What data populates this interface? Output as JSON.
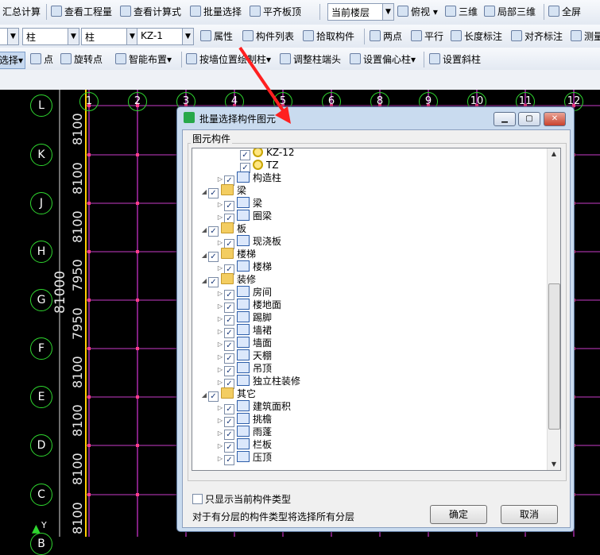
{
  "toolbar1": {
    "items": [
      "汇总计算",
      "查看工程量",
      "查看计算式",
      "批量选择",
      "平齐板顶"
    ],
    "floor_combo": "当前楼层",
    "view_items": [
      "俯视",
      "三维",
      "局部三维",
      "全屏"
    ]
  },
  "toolbar2": {
    "combo1": "柱",
    "combo2": "柱",
    "combo3": "KZ-1",
    "items": [
      "属性",
      "构件列表",
      "拾取构件",
      "两点",
      "平行",
      "长度标注",
      "对齐标注",
      "测量"
    ]
  },
  "toolbar3": {
    "items": [
      "选择",
      "点",
      "旋转点",
      "智能布置",
      "按墙位置绘制柱",
      "调整柱端头",
      "设置偏心柱",
      "设置斜柱"
    ]
  },
  "canvas": {
    "axis_rows": [
      "L",
      "K",
      "J",
      "H",
      "G",
      "F",
      "E",
      "D",
      "C",
      "B"
    ],
    "col_numbers": [
      "1",
      "2",
      "3",
      "4",
      "5",
      "6",
      "8",
      "9",
      "10",
      "11",
      "12"
    ],
    "dims": [
      "8100",
      "8100",
      "8100",
      "7950",
      "7950",
      "8100",
      "8100",
      "8100",
      "8100"
    ],
    "total_dim": "81000",
    "y_axis_label": "Y"
  },
  "dialog": {
    "title": "批量选择构件图元",
    "group_label": "图元构件",
    "tree": [
      {
        "label": "KZ-12",
        "level": 3,
        "icon": "gear-icon"
      },
      {
        "label": "TZ",
        "level": 3,
        "icon": "gear-icon"
      },
      {
        "label": "构造柱",
        "level": 2,
        "icon": "component-icon"
      },
      {
        "label": "梁",
        "level": 1,
        "icon": "folder-icon"
      },
      {
        "label": "梁",
        "level": 2,
        "icon": "component-icon"
      },
      {
        "label": "圈梁",
        "level": 2,
        "icon": "component-icon"
      },
      {
        "label": "板",
        "level": 1,
        "icon": "folder-icon"
      },
      {
        "label": "现浇板",
        "level": 2,
        "icon": "component-icon"
      },
      {
        "label": "楼梯",
        "level": 1,
        "icon": "folder-icon"
      },
      {
        "label": "楼梯",
        "level": 2,
        "icon": "component-icon"
      },
      {
        "label": "装修",
        "level": 1,
        "icon": "folder-icon"
      },
      {
        "label": "房间",
        "level": 2,
        "icon": "component-icon"
      },
      {
        "label": "楼地面",
        "level": 2,
        "icon": "component-icon"
      },
      {
        "label": "踢脚",
        "level": 2,
        "icon": "component-icon"
      },
      {
        "label": "墙裙",
        "level": 2,
        "icon": "component-icon"
      },
      {
        "label": "墙面",
        "level": 2,
        "icon": "component-icon"
      },
      {
        "label": "天棚",
        "level": 2,
        "icon": "component-icon"
      },
      {
        "label": "吊顶",
        "level": 2,
        "icon": "component-icon"
      },
      {
        "label": "独立柱装修",
        "level": 2,
        "icon": "component-icon"
      },
      {
        "label": "其它",
        "level": 1,
        "icon": "folder-icon"
      },
      {
        "label": "建筑面积",
        "level": 2,
        "icon": "component-icon"
      },
      {
        "label": "挑檐",
        "level": 2,
        "icon": "component-icon"
      },
      {
        "label": "雨蓬",
        "level": 2,
        "icon": "component-icon"
      },
      {
        "label": "栏板",
        "level": 2,
        "icon": "component-icon"
      },
      {
        "label": "压顶",
        "level": 2,
        "icon": "component-icon"
      }
    ],
    "only_current_label": "只显示当前构件类型",
    "hint": "对于有分层的构件类型将选择所有分层",
    "ok_label": "确定",
    "cancel_label": "取消"
  },
  "colors": {
    "grid_green": "#2fd62f",
    "axis_magenta": "#ff40ff",
    "arrow_red": "#ff2020",
    "dialog_bg": "#c9dbef"
  }
}
